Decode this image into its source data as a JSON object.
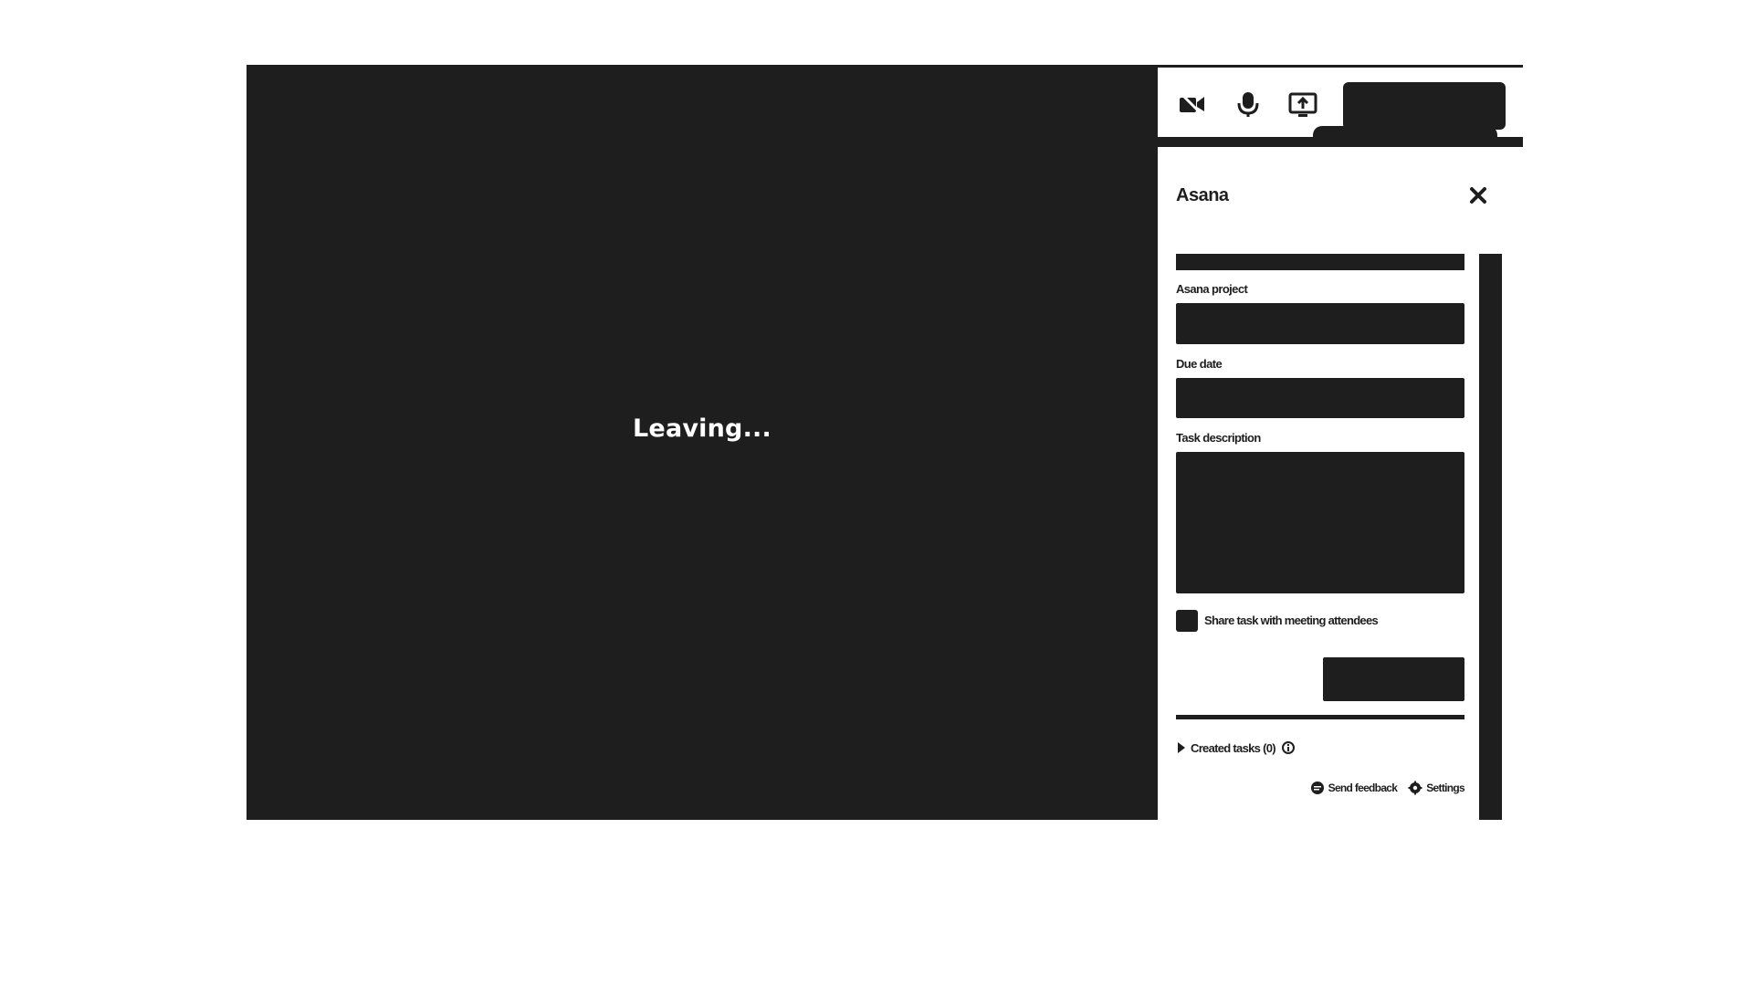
{
  "meeting": {
    "status_text": "Leaving..."
  },
  "controls": {
    "icons": [
      "camera-off-icon",
      "microphone-icon",
      "share-screen-icon"
    ],
    "leave_label": "",
    "tooltip_text": ""
  },
  "panel": {
    "title": "Asana",
    "close_icon": "close-icon",
    "fields": {
      "project_label": "Asana project",
      "project_value": "",
      "due_date_label": "Due date",
      "due_date_value": "",
      "description_label": "Task description",
      "description_value": ""
    },
    "checkbox_label": "Share task with meeting attendees",
    "submit_label": "",
    "created_tasks_label": "Created tasks (0)",
    "footer": {
      "feedback_label": "Send feedback",
      "settings_label": "Settings"
    }
  },
  "colors": {
    "dark": "#1e1e1e",
    "background": "#ffffff",
    "text_on_dark": "#ffffff"
  }
}
